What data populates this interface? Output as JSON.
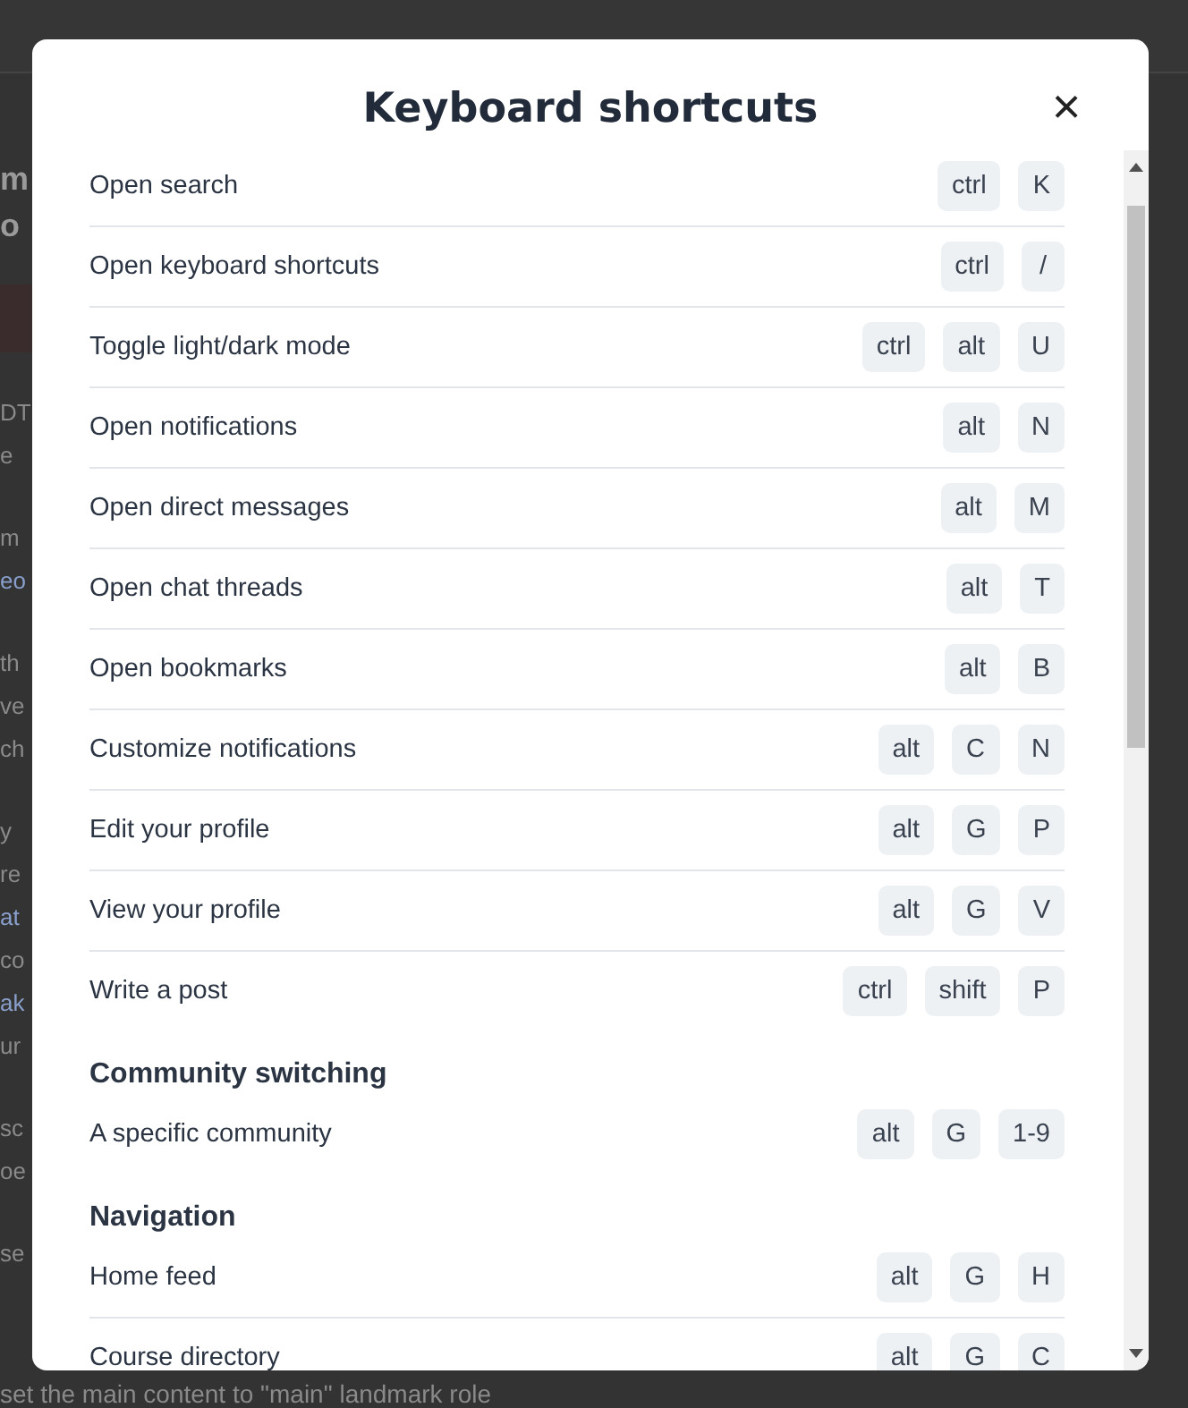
{
  "background": {
    "heading": [
      "m",
      "o"
    ],
    "paragraphs": [
      [
        {
          "text": "DT",
          "kind": "text"
        },
        {
          "text": "e",
          "kind": "text"
        }
      ],
      [
        {
          "text": "m",
          "kind": "text"
        },
        {
          "text": "eo",
          "kind": "link"
        }
      ],
      [
        {
          "text": "th",
          "kind": "text"
        },
        {
          "text": "ve",
          "kind": "text"
        },
        {
          "text": "ch",
          "kind": "text"
        }
      ],
      [
        {
          "text": "y",
          "kind": "text"
        },
        {
          "text": "re",
          "kind": "text"
        },
        {
          "text": "at",
          "kind": "link"
        },
        {
          "text": "co",
          "kind": "text"
        },
        {
          "text": "ak",
          "kind": "link"
        },
        {
          "text": "ur",
          "kind": "text"
        }
      ],
      [
        {
          "text": "sc",
          "kind": "text"
        },
        {
          "text": "oe",
          "kind": "text"
        }
      ],
      [
        {
          "text": "se",
          "kind": "text"
        }
      ]
    ],
    "footer_line": "set the main content to \"main\" landmark role"
  },
  "modal": {
    "title": "Keyboard shortcuts",
    "close": "×",
    "sections": [
      {
        "shortcuts": [
          {
            "label": "Open search",
            "keys": [
              "ctrl",
              "K"
            ]
          },
          {
            "label": "Open keyboard shortcuts",
            "keys": [
              "ctrl",
              "/"
            ]
          },
          {
            "label": "Toggle light/dark mode",
            "keys": [
              "ctrl",
              "alt",
              "U"
            ]
          },
          {
            "label": "Open notifications",
            "keys": [
              "alt",
              "N"
            ]
          },
          {
            "label": "Open direct messages",
            "keys": [
              "alt",
              "M"
            ]
          },
          {
            "label": "Open chat threads",
            "keys": [
              "alt",
              "T"
            ]
          },
          {
            "label": "Open bookmarks",
            "keys": [
              "alt",
              "B"
            ]
          },
          {
            "label": "Customize notifications",
            "keys": [
              "alt",
              "C",
              "N"
            ]
          },
          {
            "label": "Edit your profile",
            "keys": [
              "alt",
              "G",
              "P"
            ]
          },
          {
            "label": "View your profile",
            "keys": [
              "alt",
              "G",
              "V"
            ]
          },
          {
            "label": "Write a post",
            "keys": [
              "ctrl",
              "shift",
              "P"
            ]
          }
        ]
      },
      {
        "heading": "Community switching",
        "shortcuts": [
          {
            "label": "A specific community",
            "keys": [
              "alt",
              "G",
              "1-9"
            ]
          }
        ]
      },
      {
        "heading": "Navigation",
        "shortcuts": [
          {
            "label": "Home feed",
            "keys": [
              "alt",
              "G",
              "H"
            ]
          },
          {
            "label": "Course directory",
            "keys": [
              "alt",
              "G",
              "C"
            ]
          }
        ]
      }
    ]
  }
}
